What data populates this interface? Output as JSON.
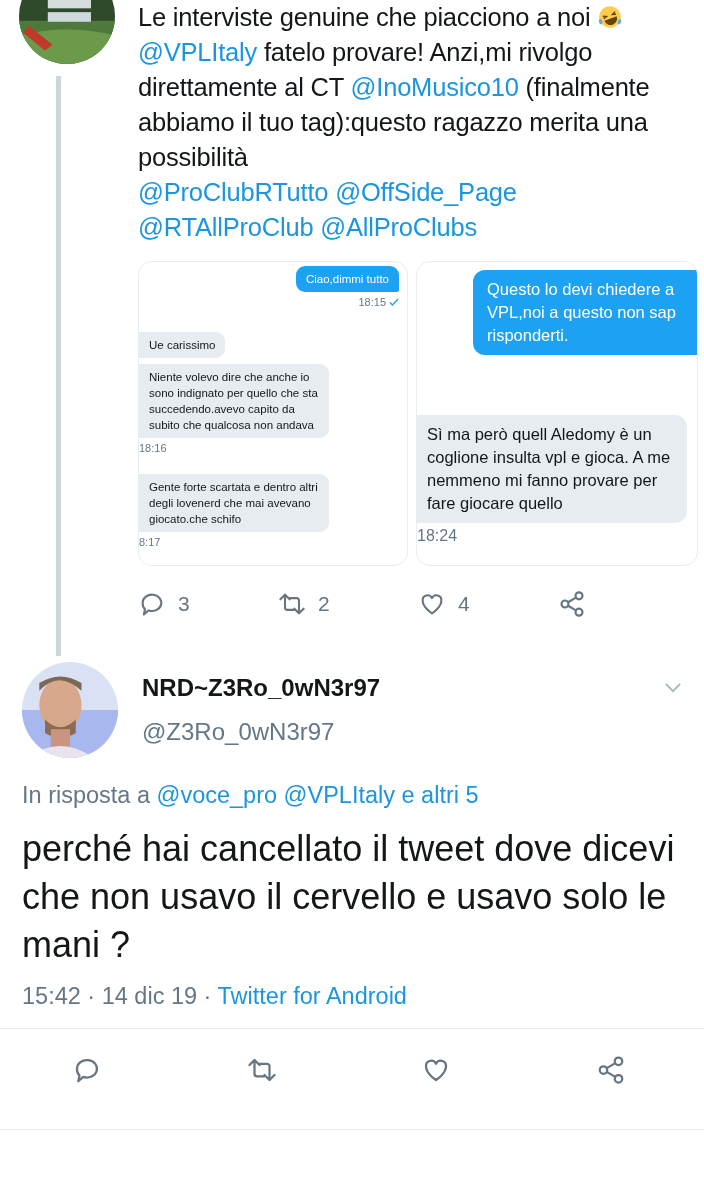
{
  "tweet": {
    "text": [
      {
        "kind": "plain",
        "text": "Le interviste genuine che piacciono a noi "
      },
      {
        "kind": "emoji"
      },
      {
        "kind": "break"
      },
      {
        "kind": "mention",
        "text": "@VPLItaly"
      },
      {
        "kind": "plain",
        "text": " fatelo provare! Anzi,mi rivolgo direttamente al CT "
      },
      {
        "kind": "mention",
        "text": "@InoMusico10"
      },
      {
        "kind": "plain",
        "text": " (finalmente abbiamo il tuo tag):questo ragazzo merita una possibilità"
      },
      {
        "kind": "break"
      },
      {
        "kind": "mention",
        "text": "@ProClubRTutto"
      },
      {
        "kind": "mention",
        "text": "@OffSide_Page"
      },
      {
        "kind": "mention",
        "text": "@RTAllProClub"
      },
      {
        "kind": "mention",
        "text": "@AllProClubs"
      }
    ],
    "images": [
      {
        "messages": [
          {
            "kind": "sent",
            "text": "Ciao,dimmi tutto"
          },
          {
            "kind": "time",
            "text": "18:15",
            "read": true
          },
          {
            "kind": "received",
            "text": "Ue carissimo"
          },
          {
            "kind": "received",
            "text": "Niente volevo dire che anche io sono indignato per quello che sta succedendo.avevo capito da subito che qualcosa non andava"
          },
          {
            "kind": "time",
            "text": "18:16",
            "read": false
          },
          {
            "kind": "received",
            "text": "Gente forte scartata e dentro altri degli lovenerd che mai avevano giocato.che schifo"
          },
          {
            "kind": "time",
            "text": "8:17",
            "read": false
          }
        ]
      },
      {
        "messages": [
          {
            "kind": "sent",
            "text": "Questo lo devi chiedere a\nVPL,noi a questo non sap\nrisponderti."
          },
          {
            "kind": "received",
            "text": "Sì ma però quell Aledomy è un coglione insulta vpl e gioca. A me nemmeno mi fanno provare per fare giocare quello"
          },
          {
            "kind": "time",
            "text": "18:24",
            "read": false
          }
        ]
      }
    ],
    "actions": [
      {
        "kind": "reply",
        "count": "3"
      },
      {
        "kind": "retweet",
        "count": "2"
      },
      {
        "kind": "like",
        "count": "4"
      },
      {
        "kind": "share"
      }
    ]
  },
  "reply": {
    "name": "NRD~Z3Ro_0wN3r97",
    "handle": "@Z3Ro_0wN3r97",
    "reply_to": [
      {
        "kind": "plain",
        "text": "In risposta a "
      },
      {
        "kind": "mention",
        "text": "@voce_pro"
      },
      {
        "kind": "mention",
        "text": "@VPLItaly"
      },
      {
        "kind": "mention",
        "text": "e altri 5"
      }
    ],
    "text": "perché hai cancellato il tweet dove dicevi che non usavo il cervello e usavo solo le mani ?",
    "meta": [
      {
        "kind": "plain",
        "text": "15:42 · 14 dic 19 · "
      },
      {
        "kind": "mention",
        "text": "Twitter for Android"
      }
    ],
    "actions": [
      {
        "kind": "reply"
      },
      {
        "kind": "retweet"
      },
      {
        "kind": "like"
      },
      {
        "kind": "share"
      }
    ]
  }
}
